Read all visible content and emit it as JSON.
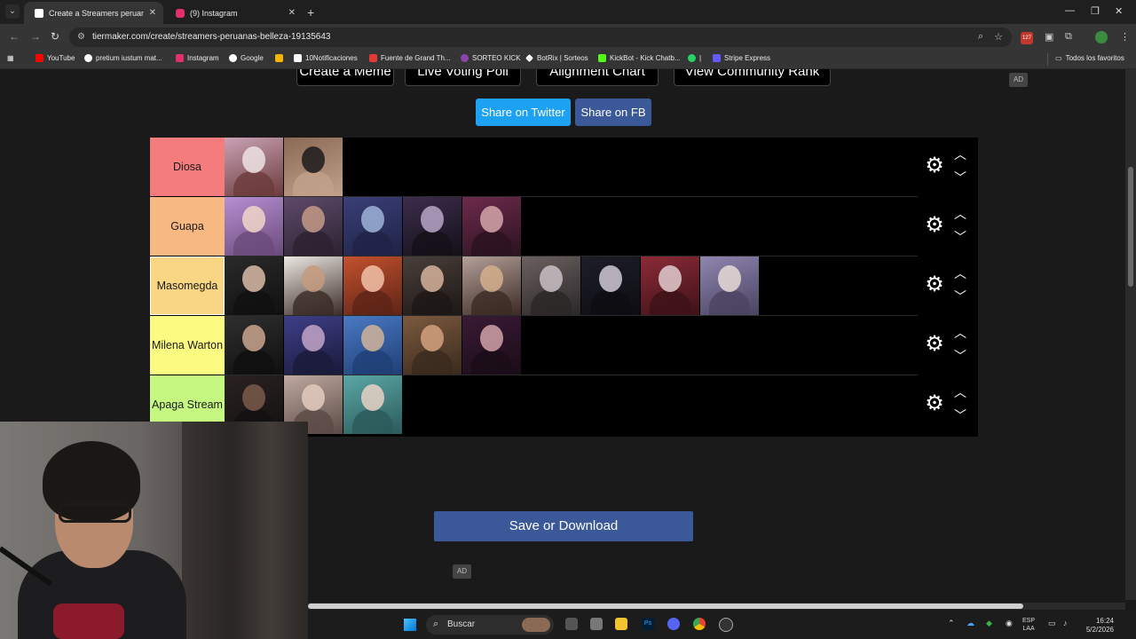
{
  "browser": {
    "tabs": [
      {
        "title": "Create a Streamers peruanas be",
        "active": true,
        "icon_color": "#ffffff"
      },
      {
        "title": "(9) Instagram",
        "active": false,
        "icon_color": "#e1306c"
      }
    ],
    "url": "tiermaker.com/create/streamers-peruanas-belleza-19135643",
    "extension_badge": "127",
    "bookmarks": [
      {
        "label": "YouTube",
        "icon": "youtube-icon",
        "color": "#ff0000"
      },
      {
        "label": "pretium iustum mat...",
        "icon": "google-icon",
        "color": "#ffffff"
      },
      {
        "label": "Instagram",
        "icon": "instagram-icon",
        "color": "#e1306c"
      },
      {
        "label": "Google",
        "icon": "google-icon",
        "color": "#ffffff"
      },
      {
        "label": "",
        "icon": "pinwheel-icon",
        "color": "#f4b400"
      },
      {
        "label": "10Notificaciones",
        "icon": "x-icon",
        "color": "#ffffff"
      },
      {
        "label": "Fuente de Grand Th...",
        "icon": "font-icon",
        "color": "#e53935"
      },
      {
        "label": "SORTEO KICK",
        "icon": "kick-icon",
        "color": "#8e44ad"
      },
      {
        "label": "BotRix | Sorteos",
        "icon": "botrix-icon",
        "color": "#ffffff"
      },
      {
        "label": "KickBot - Kick Chatb...",
        "icon": "kickbot-icon",
        "color": "#53fc18"
      },
      {
        "label": "|",
        "icon": "whatsapp-icon",
        "color": "#25d366"
      },
      {
        "label": "Stripe Express",
        "icon": "stripe-icon",
        "color": "#635bff"
      }
    ],
    "bookmarks_folder": "Todos los favoritos"
  },
  "page": {
    "top_buttons": [
      "Create a Meme",
      "Live Voting Poll",
      "Alignment Chart",
      "View Community Rank"
    ],
    "ad_label": "AD",
    "share_twitter": "Share on Twitter",
    "share_fb": "Share on FB",
    "save_button": "Save or Download",
    "colors": {
      "twitter": "#1da1f2",
      "fb": "#3b5998",
      "save": "#3b5998"
    }
  },
  "tiers": [
    {
      "label": "Diosa",
      "color": "#f47c7c",
      "items": 2
    },
    {
      "label": "Guapa",
      "color": "#f8b882",
      "items": 5
    },
    {
      "label": "Masomegda",
      "color": "#f8d683",
      "items": 9,
      "selected": true
    },
    {
      "label": "Milena Warton",
      "color": "#fbfb82",
      "items": 5
    },
    {
      "label": "Apaga Stream",
      "color": "#c6f781",
      "items": 3
    }
  ],
  "taskbar": {
    "search_placeholder": "Buscar",
    "lang_top": "ESP",
    "lang_bottom": "LAA",
    "time": "16:24",
    "date": "5/2/2026"
  }
}
